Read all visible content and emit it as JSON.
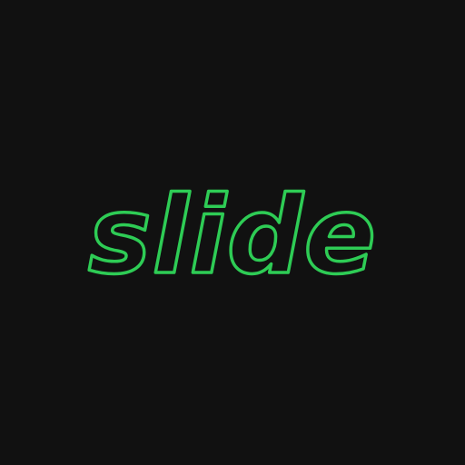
{
  "background_color": "#111111",
  "word": {
    "text": "slide",
    "stroke_color": "#2ecc55",
    "style": "outlined italic bold"
  }
}
